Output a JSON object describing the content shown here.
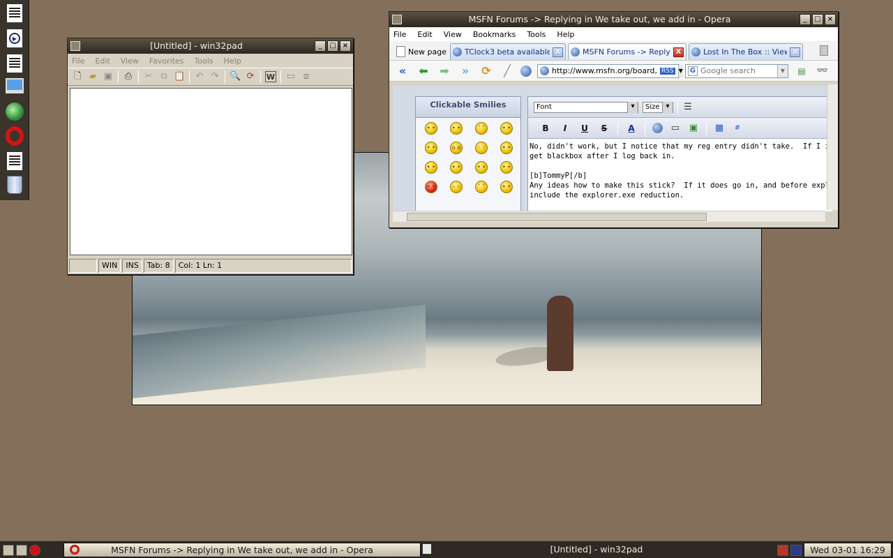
{
  "win32pad": {
    "title": "[Untitled] - win32pad",
    "menu": [
      "File",
      "Edit",
      "View",
      "Favorites",
      "Tools",
      "Help"
    ],
    "status": {
      "mode": "WIN",
      "ins": "INS",
      "tab": "Tab: 8",
      "position": "Col: 1 Ln: 1"
    }
  },
  "opera": {
    "title": "MSFN Forums -> Replying in We take out, we add in - Opera",
    "menu": [
      "File",
      "Edit",
      "View",
      "Bookmarks",
      "Tools",
      "Help"
    ],
    "new_page_label": "New page",
    "tabs": [
      {
        "label": "TClock3 beta available ..."
      },
      {
        "label": "MSFN Forums -> Replyi..."
      },
      {
        "label": "Lost In The Box :: View ..."
      }
    ],
    "address": "http://www.msfn.org/board,",
    "rss_label": "RSS",
    "search_placeholder": "Google search",
    "smilies_title": "Clickable Smilies",
    "font_label": "Font",
    "size_label": "Size",
    "format_buttons": [
      "B",
      "I",
      "U",
      "S"
    ],
    "editor_text": "No, didn't work, but I notice that my reg entry didn't take.  If I install my in\nget blackbox after I log back in.\n\n[b]TommyP[/b]\nAny ideas how to make this stick?  If it does go in, and before explorer is r\ninclude the explorer.exe reduction."
  },
  "taskbar": {
    "task_opera": "MSFN Forums -> Replying in We take out, we add in - Opera",
    "task_pad": "[Untitled] - win32pad",
    "clock": "Wed 03-01 16:29"
  }
}
